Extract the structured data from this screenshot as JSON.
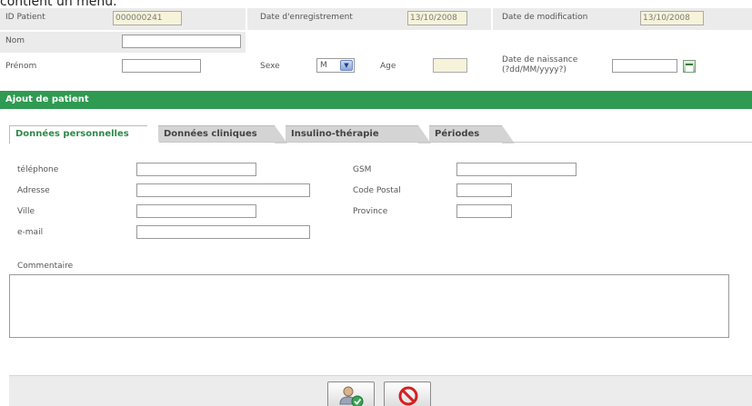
{
  "caption": "contient un menu.",
  "header": {
    "id_patient_label": "ID Patient",
    "id_patient_value": "000000241",
    "date_enregistrement_label": "Date d'enregistrement",
    "date_enregistrement_value": "13/10/2008",
    "date_modification_label": "Date de modification",
    "date_modification_value": "13/10/2008",
    "nom_label": "Nom",
    "prenom_label": "Prénom",
    "sexe_label": "Sexe",
    "sexe_value": "M",
    "age_label": "Age",
    "date_naissance_label_line1": "Date de naissance",
    "date_naissance_label_line2": "(?dd/MM/yyyy?)"
  },
  "section_title": "Ajout de patient",
  "tabs": [
    {
      "label": "Données personnelles",
      "active": true
    },
    {
      "label": "Données cliniques",
      "active": false
    },
    {
      "label": "Insulino-thérapie",
      "active": false
    },
    {
      "label": "Périodes",
      "active": false
    }
  ],
  "form": {
    "telephone_label": "téléphone",
    "adresse_label": "Adresse",
    "ville_label": "Ville",
    "email_label": "e-mail",
    "gsm_label": "GSM",
    "code_postal_label": "Code Postal",
    "province_label": "Province",
    "commentaire_label": "Commentaire"
  },
  "icons": {
    "save": "save-user-icon",
    "cancel": "cancel-icon",
    "calendar": "calendar-icon",
    "dropdown": "chevron-down-icon"
  },
  "colors": {
    "accent_green": "#2f9a52",
    "readonly_field": "#f6f3da"
  }
}
